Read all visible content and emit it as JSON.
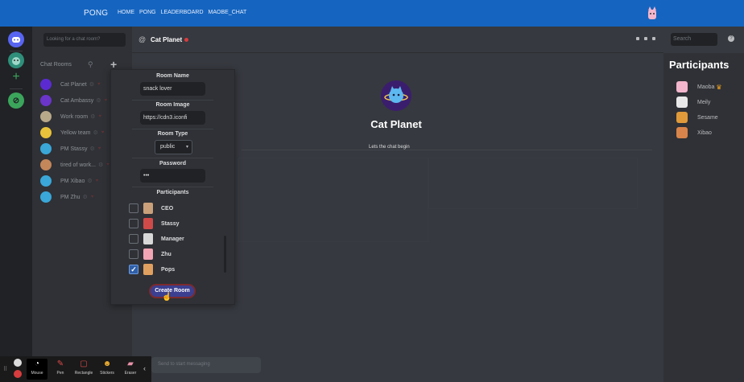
{
  "nav": {
    "brand": "PONG",
    "links": [
      "HOME",
      "PONG",
      "LEADERBOARD",
      "MAOBE_CHAT"
    ]
  },
  "sidebar": {
    "search_placeholder": "Looking for a chat room?",
    "rooms_header": "Chat Rooms",
    "rooms": [
      {
        "name": "Cat Planet",
        "color": "#5b2bd1"
      },
      {
        "name": "Cat Ambassy",
        "color": "#6a35c8"
      },
      {
        "name": "Work room",
        "color": "#b8a98a"
      },
      {
        "name": "Yellow team",
        "color": "#e8c23a"
      },
      {
        "name": "PM Stassy",
        "color": "#3aa7d8"
      },
      {
        "name": "tired of work...",
        "color": "#c4875a"
      },
      {
        "name": "PM Xibao",
        "color": "#3aa7d8"
      },
      {
        "name": "PM Zhu",
        "color": "#3aa7d8"
      }
    ]
  },
  "chat": {
    "room_title": "Cat Planet",
    "welcome_title": "Cat Planet",
    "welcome_subtitle": "Lets the chat begin",
    "message_placeholder": "Send to start messaging",
    "search_placeholder": "Search",
    "help_glyph": "?"
  },
  "participants": {
    "title": "Participants",
    "members": [
      {
        "name": "Maoba",
        "crown": true,
        "color": "#f3b6cc"
      },
      {
        "name": "Meily",
        "crown": false,
        "color": "#e8e8e8"
      },
      {
        "name": "Sesame",
        "crown": false,
        "color": "#e09a3a"
      },
      {
        "name": "Xibao",
        "crown": false,
        "color": "#d9844a"
      }
    ]
  },
  "create_room": {
    "room_name_label": "Room Name",
    "room_name_value": "snack lover",
    "room_image_label": "Room Image",
    "room_image_value": "https://cdn3.iconfi",
    "room_type_label": "Room Type",
    "room_type_value": "public",
    "password_label": "Password",
    "password_value": "•••",
    "participants_label": "Participants",
    "people": [
      {
        "name": "CEO",
        "checked": false,
        "color": "#c9a07a"
      },
      {
        "name": "Stassy",
        "checked": false,
        "color": "#d04a4a"
      },
      {
        "name": "Manager",
        "checked": false,
        "color": "#d8d8d8"
      },
      {
        "name": "Zhu",
        "checked": false,
        "color": "#f2a5b5"
      },
      {
        "name": "Pops",
        "checked": true,
        "color": "#e0a060"
      }
    ],
    "submit_label": "Create Room"
  },
  "recorder": {
    "tools": [
      {
        "label": "Mouse",
        "icon": "mouse-icon",
        "glyph": "◔",
        "color": "#ffffff"
      },
      {
        "label": "Pen",
        "icon": "pen-icon",
        "glyph": "✎",
        "color": "#e04a4a"
      },
      {
        "label": "Rectangle",
        "icon": "rectangle-icon",
        "glyph": "▢",
        "color": "#e04a4a"
      },
      {
        "label": "Stickers",
        "icon": "stickers-icon",
        "glyph": "☻",
        "color": "#f0b030"
      },
      {
        "label": "Eraser",
        "icon": "eraser-icon",
        "glyph": "▰",
        "color": "#e890a8"
      }
    ]
  }
}
